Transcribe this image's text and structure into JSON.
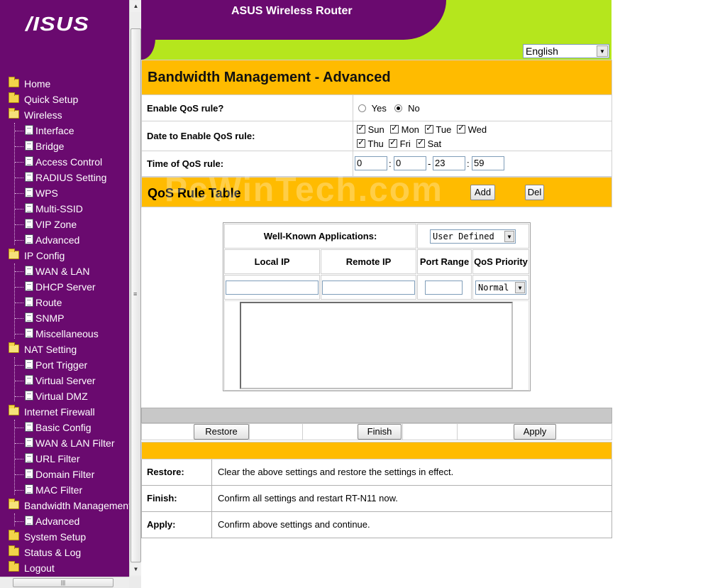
{
  "banner": {
    "title": "ASUS Wireless Router",
    "logo": "/ISUS"
  },
  "language": {
    "selected": "English"
  },
  "page": {
    "title": "Bandwidth Management - Advanced"
  },
  "sidebar": {
    "items": [
      {
        "label": "Home"
      },
      {
        "label": "Quick Setup"
      },
      {
        "label": "Wireless"
      },
      {
        "label": "Interface"
      },
      {
        "label": "Bridge"
      },
      {
        "label": "Access Control"
      },
      {
        "label": "RADIUS Setting"
      },
      {
        "label": "WPS"
      },
      {
        "label": "Multi-SSID"
      },
      {
        "label": "VIP Zone"
      },
      {
        "label": "Advanced"
      },
      {
        "label": "IP Config"
      },
      {
        "label": "WAN & LAN"
      },
      {
        "label": "DHCP Server"
      },
      {
        "label": "Route"
      },
      {
        "label": "SNMP"
      },
      {
        "label": "Miscellaneous"
      },
      {
        "label": "NAT Setting"
      },
      {
        "label": "Port Trigger"
      },
      {
        "label": "Virtual Server"
      },
      {
        "label": "Virtual DMZ"
      },
      {
        "label": "Internet Firewall"
      },
      {
        "label": "Basic Config"
      },
      {
        "label": "WAN & LAN Filter"
      },
      {
        "label": "URL Filter"
      },
      {
        "label": "Domain Filter"
      },
      {
        "label": "MAC Filter"
      },
      {
        "label": "Bandwidth Management"
      },
      {
        "label": "Advanced"
      },
      {
        "label": "System Setup"
      },
      {
        "label": "Status & Log"
      },
      {
        "label": "Logout"
      }
    ]
  },
  "form": {
    "enable_label": "Enable QoS rule?",
    "yes_label": "Yes",
    "no_label": "No",
    "enabled": "No",
    "date_label": "Date to Enable QoS rule:",
    "days": [
      {
        "label": "Sun",
        "checked": true
      },
      {
        "label": "Mon",
        "checked": true
      },
      {
        "label": "Tue",
        "checked": true
      },
      {
        "label": "Wed",
        "checked": true
      },
      {
        "label": "Thu",
        "checked": true
      },
      {
        "label": "Fri",
        "checked": true
      },
      {
        "label": "Sat",
        "checked": true
      }
    ],
    "time_label": "Time of QoS rule:",
    "time_start_hour": "0",
    "time_start_min": "0",
    "time_end_hour": "23",
    "time_end_min": "59",
    "colon": ":",
    "dash": "-"
  },
  "qos": {
    "title": "QoS Rule Table",
    "add_label": "Add",
    "del_label": "Del",
    "watermark": "PcWinTech.com",
    "apps_label": "Well-Known Applications:",
    "apps_selected": "User Defined",
    "col_local_ip": "Local IP",
    "col_remote_ip": "Remote IP",
    "col_port_range": "Port Range",
    "col_priority": "QoS Priority",
    "priority_selected": "Normal",
    "local_ip_value": "",
    "remote_ip_value": "",
    "port_range_value": ""
  },
  "actions": {
    "restore_label": "Restore",
    "finish_label": "Finish",
    "apply_label": "Apply"
  },
  "help": [
    {
      "key": "Restore:",
      "text": "Clear the above settings and restore the settings in effect."
    },
    {
      "key": "Finish:",
      "text": "Confirm all settings and restart RT-N11 now."
    },
    {
      "key": "Apply:",
      "text": "Confirm above settings and continue."
    }
  ],
  "colors": {
    "purple": "#6a0a6f",
    "orange": "#ffbb00",
    "lime": "#b5e61d"
  }
}
